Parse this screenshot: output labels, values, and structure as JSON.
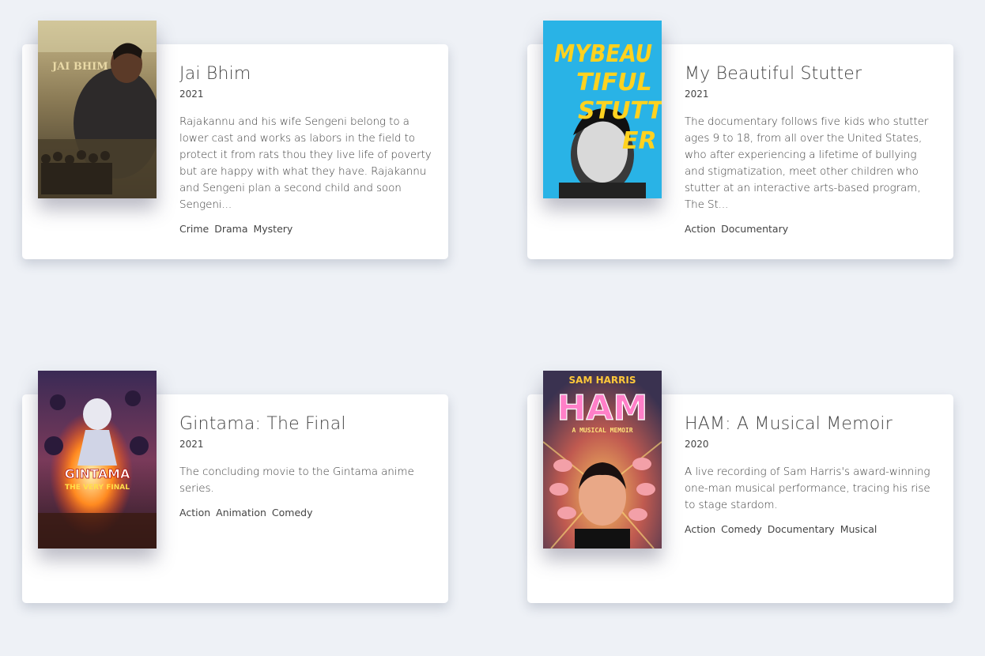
{
  "movies": [
    {
      "title": "Jai Bhim",
      "year": "2021",
      "description": "Rajakannu and his wife Sengeni belong to a lower cast and works as labors in the field to protect it from rats thou they live life of poverty but are happy with what they have. Rajakannu and Sengeni plan a second child and soon Sengeni...",
      "genres": [
        "Crime",
        "Drama",
        "Mystery"
      ],
      "poster_text": "JAI BHIM"
    },
    {
      "title": "My Beautiful Stutter",
      "year": "2021",
      "description": "The documentary follows five kids who stutter ages 9 to 18, from all over the United States, who after experiencing a lifetime of bullying and stigmatization, meet other children who stutter at an interactive arts-based program, The St...",
      "genres": [
        "Action",
        "Documentary"
      ],
      "poster_text": [
        "MYBEAU",
        "TIFUL",
        "STUTT",
        "ER"
      ]
    },
    {
      "title": "Gintama: The Final",
      "year": "2021",
      "description": "The concluding movie to the Gintama anime series.",
      "genres": [
        "Action",
        "Animation",
        "Comedy"
      ],
      "poster_text": [
        "GINTAMA",
        "THE VERY FINAL"
      ]
    },
    {
      "title": "HAM: A Musical Memoir",
      "year": "2020",
      "description": "A live recording of Sam Harris's award-winning one-man musical performance, tracing his rise to stage stardom.",
      "genres": [
        "Action",
        "Comedy",
        "Documentary",
        "Musical"
      ],
      "poster_text": [
        "SAM HARRIS",
        "HAM",
        "A MUSICAL MEMOIR"
      ]
    }
  ]
}
